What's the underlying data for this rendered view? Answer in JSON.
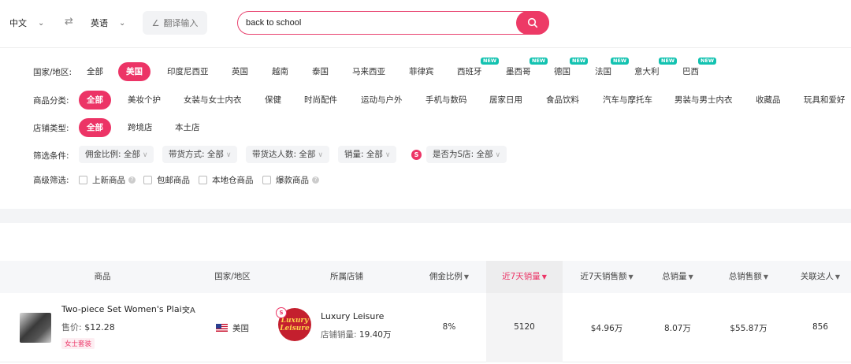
{
  "topbar": {
    "source_lang": "中文",
    "target_lang": "英语",
    "translate_label": "翻译输入",
    "search_value": "back to school"
  },
  "filters": {
    "country": {
      "label": "国家/地区:",
      "options": [
        "全部",
        "美国",
        "印度尼西亚",
        "英国",
        "越南",
        "泰国",
        "马来西亚",
        "菲律宾",
        "西班牙",
        "墨西哥",
        "德国",
        "法国",
        "意大利",
        "巴西"
      ],
      "new_badge": "NEW"
    },
    "category": {
      "label": "商品分类:",
      "options": [
        "全部",
        "美妆个护",
        "女装与女士内衣",
        "保健",
        "时尚配件",
        "运动与户外",
        "手机与数码",
        "居家日用",
        "食品饮料",
        "汽车与摩托车",
        "男装与男士内衣",
        "收藏品",
        "玩具和爱好"
      ]
    },
    "store_type": {
      "label": "店铺类型:",
      "options": [
        "全部",
        "跨境店",
        "本土店"
      ]
    },
    "conditions": {
      "label": "筛选条件:",
      "commission": "佣金比例: 全部",
      "method": "带货方式: 全部",
      "influencers": "带货达人数: 全部",
      "sales": "销量: 全部",
      "s_store": "是否为S店: 全部"
    },
    "advanced": {
      "label": "高级筛选:",
      "new_product": "上新商品",
      "free_shipping": "包邮商品",
      "local_warehouse": "本地仓商品",
      "hot": "爆款商品"
    }
  },
  "table": {
    "headers": {
      "product": "商品",
      "country": "国家/地区",
      "store": "所属店铺",
      "commission": "佣金比例",
      "sales_7d": "近7天销量",
      "revenue_7d": "近7天销售额",
      "total_sales": "总销量",
      "total_revenue": "总销售额",
      "influencers": "关联达人"
    },
    "rows": [
      {
        "name": "Two-piece Set Women's Plai···",
        "translate_icon": "文A",
        "price_label": "售价:",
        "price": "$12.28",
        "tag": "女士套装",
        "country": "美国",
        "store_logo_text": "Luxury Leisure",
        "store_name": "Luxury Leisure",
        "store_sales_label": "店铺销量:",
        "store_sales": "19.40万",
        "commission": "8%",
        "sales_7d": "5120",
        "revenue_7d": "$4.96万",
        "total_sales": "8.07万",
        "total_revenue": "$55.87万",
        "influencers": "856"
      }
    ]
  },
  "colors": {
    "accent": "#ec3466",
    "new_badge": "#12c2b0"
  }
}
